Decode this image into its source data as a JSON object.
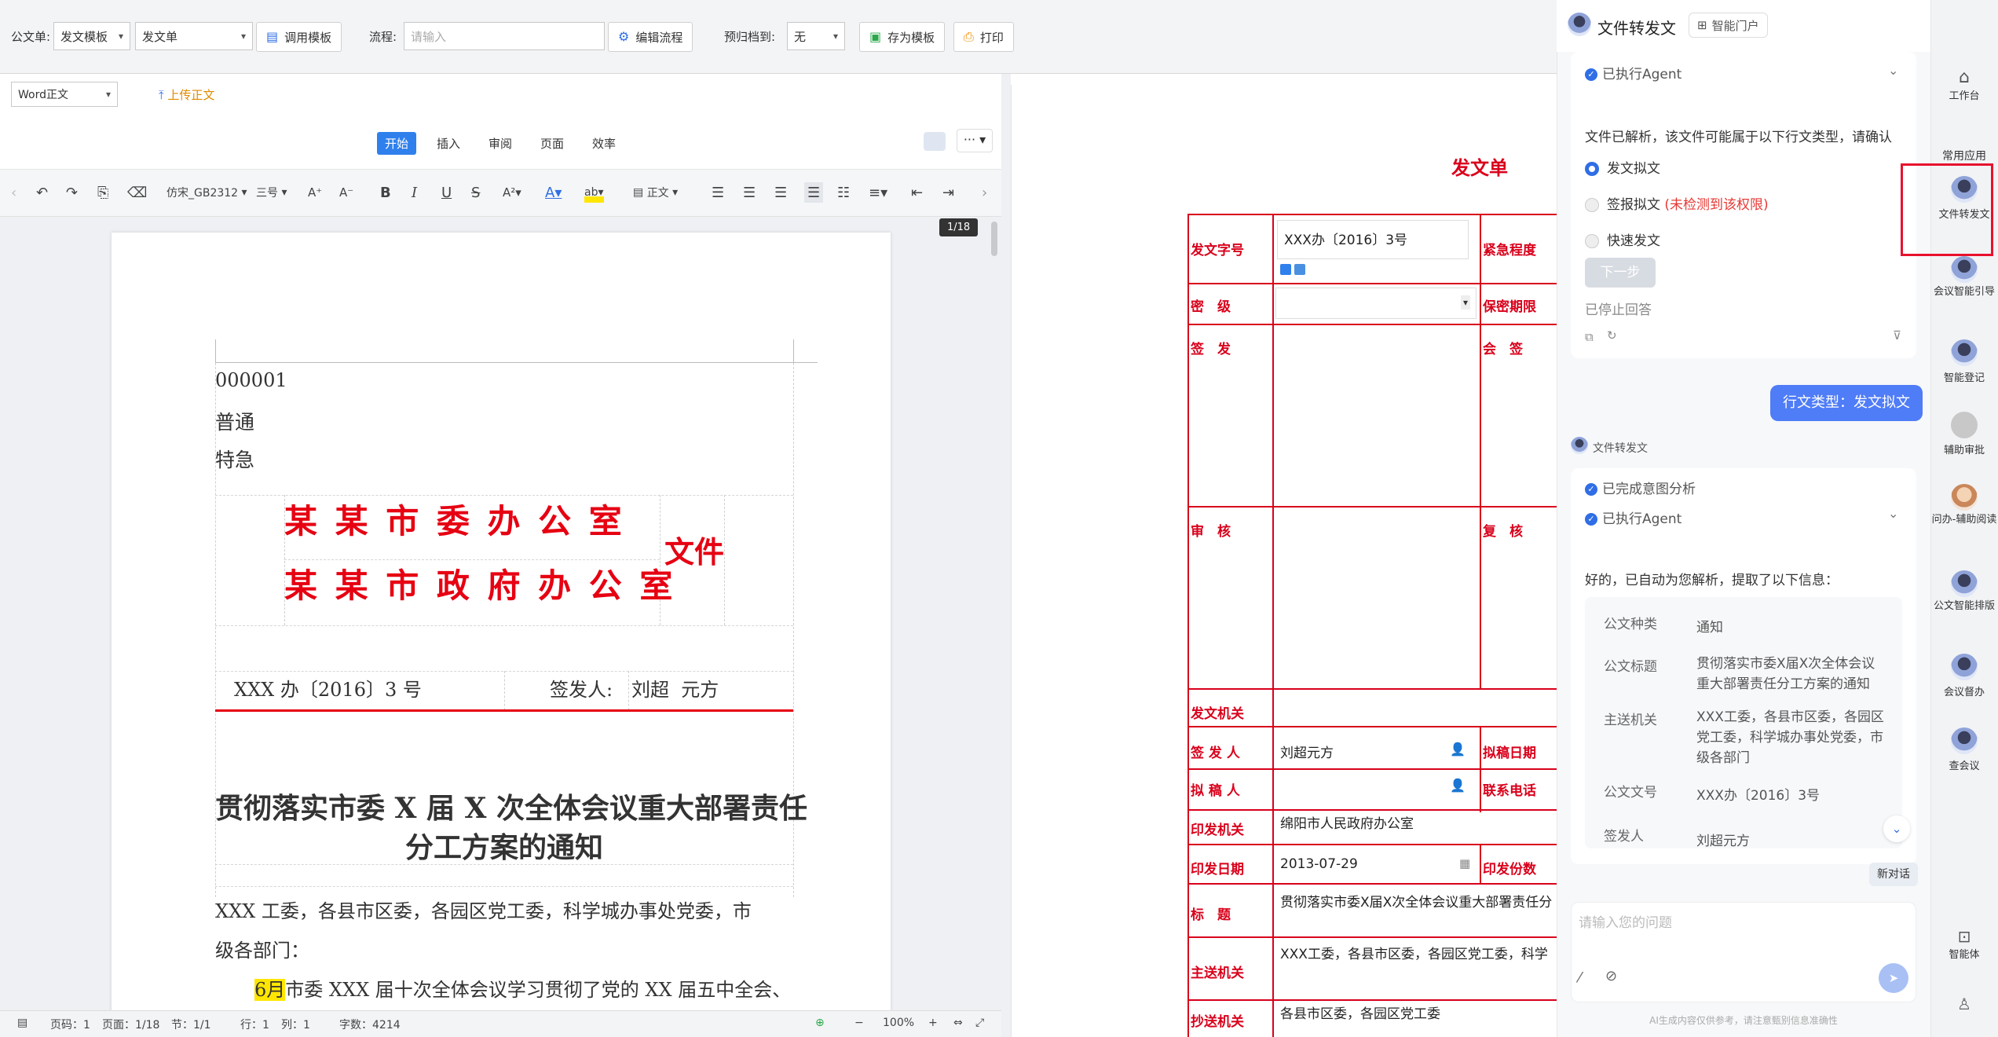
{
  "topbar": {
    "doc_label": "公文单:",
    "template_select": "发文模板",
    "form_select": "发文单",
    "load_template_btn": "调用模板",
    "flow_label": "流程:",
    "flow_placeholder": "请输入",
    "edit_flow_btn": "编辑流程",
    "archive_label": "预归档到:",
    "archive_select": "无",
    "save_template_btn": "存为模板",
    "print_btn": "打印"
  },
  "editor": {
    "body_type_select": "Word正文",
    "upload_label": "上传正文",
    "tabs": [
      "开始",
      "插入",
      "审阅",
      "页面",
      "效率"
    ],
    "font_name": "仿宋_GB2312",
    "font_size": "三号",
    "style_label": "正文",
    "page_indicator": "1/18"
  },
  "document": {
    "serial": "000001",
    "secrecy": "普通",
    "urgency": "特急",
    "org_line1": "某 某 市 委 办 公 室",
    "org_line2": "某 某 市 政 府 办 公 室",
    "doc_suffix": "文件",
    "doc_number": "XXX 办〔2016〕3 号",
    "signer_label": "签发人:",
    "signer_names": "刘超  元方",
    "title_line1": "贯彻落实市委 X 届 X 次全体会议重大部署责任",
    "title_line2": "分工方案的通知",
    "recipients_line1": "XXX 工委，各县市区委，各园区党工委，科学城办事处党委，市",
    "recipients_line2": "级各部门：",
    "highlight_word": "6月",
    "body_line": "市委 XXX 届十次全体会议学习贯彻了党的 XX 届五中全会、"
  },
  "statusbar": {
    "page_code": "页码：1",
    "page": "页面：1/18",
    "section": "节：1/1",
    "row": "行：1",
    "col": "列：1",
    "word_count": "字数：4214",
    "zoom": "100%"
  },
  "form": {
    "title": "发文单",
    "rows": {
      "doc_no_label": "发文字号",
      "doc_no_value": "XXX办〔2016〕3号",
      "urgency_label": "紧急程度",
      "secret_label": "密　级",
      "secret_period_label": "保密期限",
      "issue_label": "签　发",
      "countersign_label": "会　签",
      "review_label": "审　核",
      "recheck_label": "复　核",
      "issuing_org_label": "发文机关",
      "issuer_label": "签 发 人",
      "issuer_value": "刘超元方",
      "draft_date_label": "拟稿日期",
      "drafter_label": "拟 稿 人",
      "phone_label": "联系电话",
      "print_org_label": "印发机关",
      "print_org_value": "绵阳市人民政府办公室",
      "print_date_label": "印发日期",
      "print_date_value": "2013-07-29",
      "print_copies_label": "印发份数",
      "title_label": "标　题",
      "title_value": "贯彻落实市委X届X次全体会议重大部署责任分",
      "main_to_label": "主送机关",
      "main_to_value": "XXX工委，各县市区委，各园区党工委，科学",
      "cc_label": "抄送机关",
      "cc_value": "各县市区委，各园区党工委"
    }
  },
  "chat": {
    "title": "文件转发文",
    "portal_btn": "智能门户",
    "executed_agent": "已执行Agent",
    "parse_msg": "文件已解析，该文件可能属于以下行文类型，请确认",
    "options": [
      {
        "label": "发文拟文",
        "note": ""
      },
      {
        "label": "签报拟文",
        "note": "(未检测到该权限)"
      },
      {
        "label": "快速发文",
        "note": ""
      }
    ],
    "next_btn": "下一步",
    "stopped": "已停止回答",
    "user_msg": "行文类型：发文拟文",
    "bot_name": "文件转发文",
    "intent_done": "已完成意图分析",
    "executed_agent2": "已执行Agent",
    "extracted_msg": "好的，已自动为您解析，提取了以下信息：",
    "fields": [
      {
        "key": "公文种类",
        "value": "通知"
      },
      {
        "key": "公文标题",
        "value": "贯彻落实市委X届X次全体会议重大部署责任分工方案的通知"
      },
      {
        "key": "主送机关",
        "value": "XXX工委，各县市区委，各园区党工委，科学城办事处党委，市级各部门"
      },
      {
        "key": "公文文号",
        "value": "XXX办〔2016〕3号"
      },
      {
        "key": "签发人",
        "value": "刘超元方"
      }
    ],
    "new_chat_btn": "新对话",
    "input_placeholder": "请输入您的问题",
    "disclaimer": "AI生成内容仅供参考，请注意甄别信息准确性"
  },
  "rail": {
    "items": [
      "工作台",
      "常用应用",
      "文件转发文",
      "会议智能引导",
      "智能登记",
      "辅助审批",
      "问办-辅助阅读",
      "公文智能排版",
      "会议督办",
      "查会议",
      "智能体"
    ]
  },
  "colors": {
    "accent": "#2f6ee6",
    "red": "#d9001b"
  }
}
